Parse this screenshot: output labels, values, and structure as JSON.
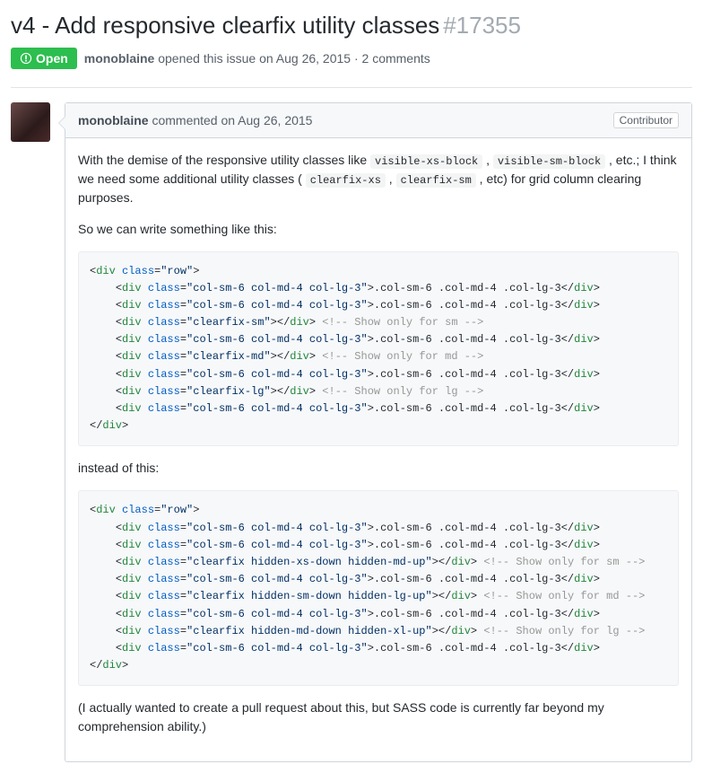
{
  "issue": {
    "title": "v4 - Add responsive clearfix utility classes",
    "number": "#17355",
    "state_label": "Open",
    "author": "monoblaine",
    "opened_text": "opened this issue on Aug 26, 2015 · 2 comments"
  },
  "comment": {
    "author": "monoblaine",
    "action": "commented on Aug 26, 2015",
    "badge": "Contributor",
    "body": {
      "p1_a": "With the demise of the responsive utility classes like ",
      "ic1": "visible-xs-block",
      "p1_sep1": " , ",
      "ic2": "visible-sm-block",
      "p1_b": " , etc.; I think we need some additional utility classes ( ",
      "ic3": "clearfix-xs",
      "p1_sep2": " , ",
      "ic4": "clearfix-sm",
      "p1_c": " , etc) for grid column clearing purposes.",
      "p2": "So we can write something like this:",
      "p3": "instead of this:",
      "p4": "(I actually wanted to create a pull request about this, but SASS code is currently far beyond my comprehension ability.)"
    },
    "code1": {
      "row_open": "<div class=\"row\">",
      "col": "<div class=\"col-sm-6 col-md-4 col-lg-3\">.col-sm-6 .col-md-4 .col-lg-3</div>",
      "clear_sm": "<div class=\"clearfix-sm\"></div> <!-- Show only for sm -->",
      "clear_md": "<div class=\"clearfix-md\"></div> <!-- Show only for md -->",
      "clear_lg": "<div class=\"clearfix-lg\"></div> <!-- Show only for lg -->",
      "row_close": "</div>"
    },
    "code2": {
      "row_open": "<div class=\"row\">",
      "col": "<div class=\"col-sm-6 col-md-4 col-lg-3\">.col-sm-6 .col-md-4 .col-lg-3</div>",
      "clear_sm": "<div class=\"clearfix hidden-xs-down hidden-md-up\"></div> <!-- Show only for sm -->",
      "clear_md": "<div class=\"clearfix hidden-sm-down hidden-lg-up\"></div> <!-- Show only for md -->",
      "clear_lg": "<div class=\"clearfix hidden-md-down hidden-xl-up\"></div> <!-- Show only for lg -->",
      "row_close": "</div>"
    }
  }
}
